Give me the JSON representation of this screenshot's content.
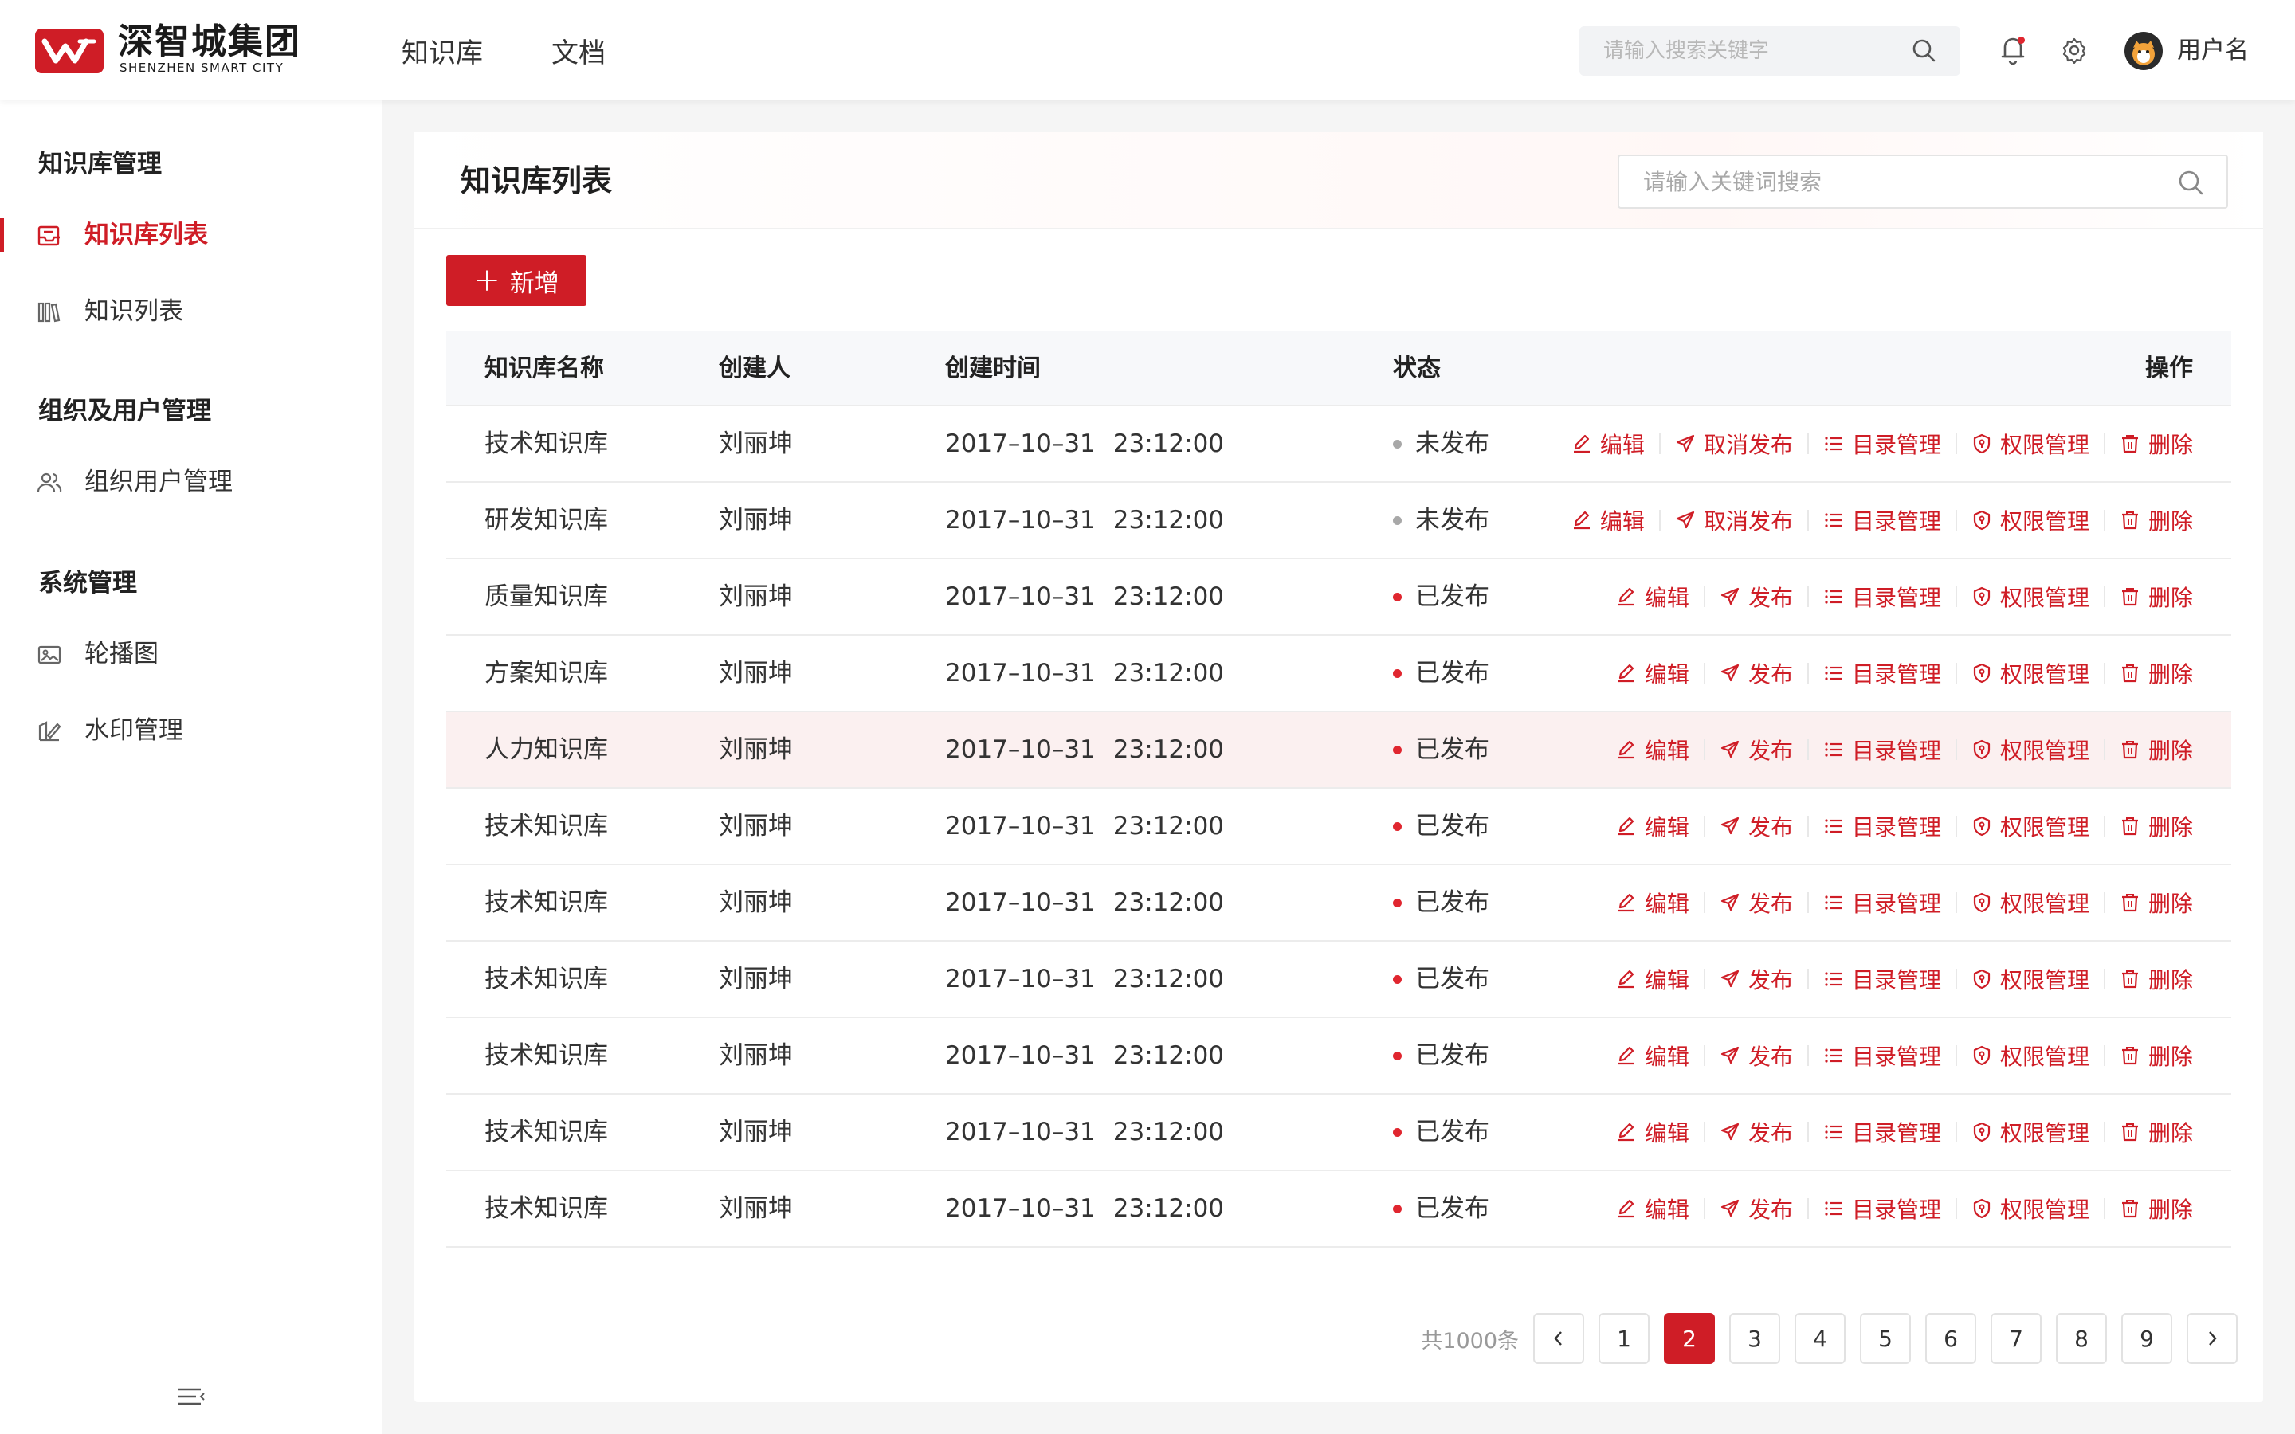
{
  "brand": {
    "name_cn": "深智城集团",
    "name_en": "SHENZHEN SMART CITY",
    "color": "#cf1d26"
  },
  "topnav": [
    {
      "label": "知识库"
    },
    {
      "label": "文档"
    }
  ],
  "header": {
    "search_placeholder": "请输入搜索关键字",
    "username": "用户名",
    "icons": [
      "bell-icon",
      "gear-icon",
      "avatar"
    ]
  },
  "sidebar": {
    "groups": [
      {
        "title": "知识库管理",
        "items": [
          {
            "label": "知识库列表",
            "icon": "inbox-icon",
            "active": true
          },
          {
            "label": "知识列表",
            "icon": "books-icon"
          }
        ]
      },
      {
        "title": "组织及用户管理",
        "items": [
          {
            "label": "组织用户管理",
            "icon": "users-icon"
          }
        ]
      },
      {
        "title": "系统管理",
        "items": [
          {
            "label": "轮播图",
            "icon": "image-icon"
          },
          {
            "label": "水印管理",
            "icon": "watermark-icon"
          }
        ]
      }
    ]
  },
  "main": {
    "title": "知识库列表",
    "search_placeholder": "请输入关键词搜索",
    "add_label": "新增",
    "columns": [
      "知识库名称",
      "创建人",
      "创建时间",
      "状态",
      "操作"
    ],
    "rows": [
      {
        "name": "技术知识库",
        "creator": "刘丽坤",
        "date": "2017–10–31",
        "time": "23:12:00",
        "status": "未发布",
        "published": false
      },
      {
        "name": "研发知识库",
        "creator": "刘丽坤",
        "date": "2017–10–31",
        "time": "23:12:00",
        "status": "未发布",
        "published": false
      },
      {
        "name": "质量知识库",
        "creator": "刘丽坤",
        "date": "2017–10–31",
        "time": "23:12:00",
        "status": "已发布",
        "published": true
      },
      {
        "name": "方案知识库",
        "creator": "刘丽坤",
        "date": "2017–10–31",
        "time": "23:12:00",
        "status": "已发布",
        "published": true
      },
      {
        "name": "人力知识库",
        "creator": "刘丽坤",
        "date": "2017–10–31",
        "time": "23:12:00",
        "status": "已发布",
        "published": true,
        "highlighted": true
      },
      {
        "name": "技术知识库",
        "creator": "刘丽坤",
        "date": "2017–10–31",
        "time": "23:12:00",
        "status": "已发布",
        "published": true
      },
      {
        "name": "技术知识库",
        "creator": "刘丽坤",
        "date": "2017–10–31",
        "time": "23:12:00",
        "status": "已发布",
        "published": true
      },
      {
        "name": "技术知识库",
        "creator": "刘丽坤",
        "date": "2017–10–31",
        "time": "23:12:00",
        "status": "已发布",
        "published": true
      },
      {
        "name": "技术知识库",
        "creator": "刘丽坤",
        "date": "2017–10–31",
        "time": "23:12:00",
        "status": "已发布",
        "published": true
      },
      {
        "name": "技术知识库",
        "creator": "刘丽坤",
        "date": "2017–10–31",
        "time": "23:12:00",
        "status": "已发布",
        "published": true
      },
      {
        "name": "技术知识库",
        "creator": "刘丽坤",
        "date": "2017–10–31",
        "time": "23:12:00",
        "status": "已发布",
        "published": true
      }
    ],
    "actions": {
      "edit": "编辑",
      "publish": "发布",
      "unpublish": "取消发布",
      "catalog": "目录管理",
      "permission": "权限管理",
      "delete": "删除"
    },
    "status_colors": {
      "published": "#e0262f",
      "unpublished": "#a8a8a8"
    }
  },
  "pagination": {
    "total_text": "共1000条",
    "pages": [
      "1",
      "2",
      "3",
      "4",
      "5",
      "6",
      "7",
      "8",
      "9"
    ],
    "current": "2"
  }
}
